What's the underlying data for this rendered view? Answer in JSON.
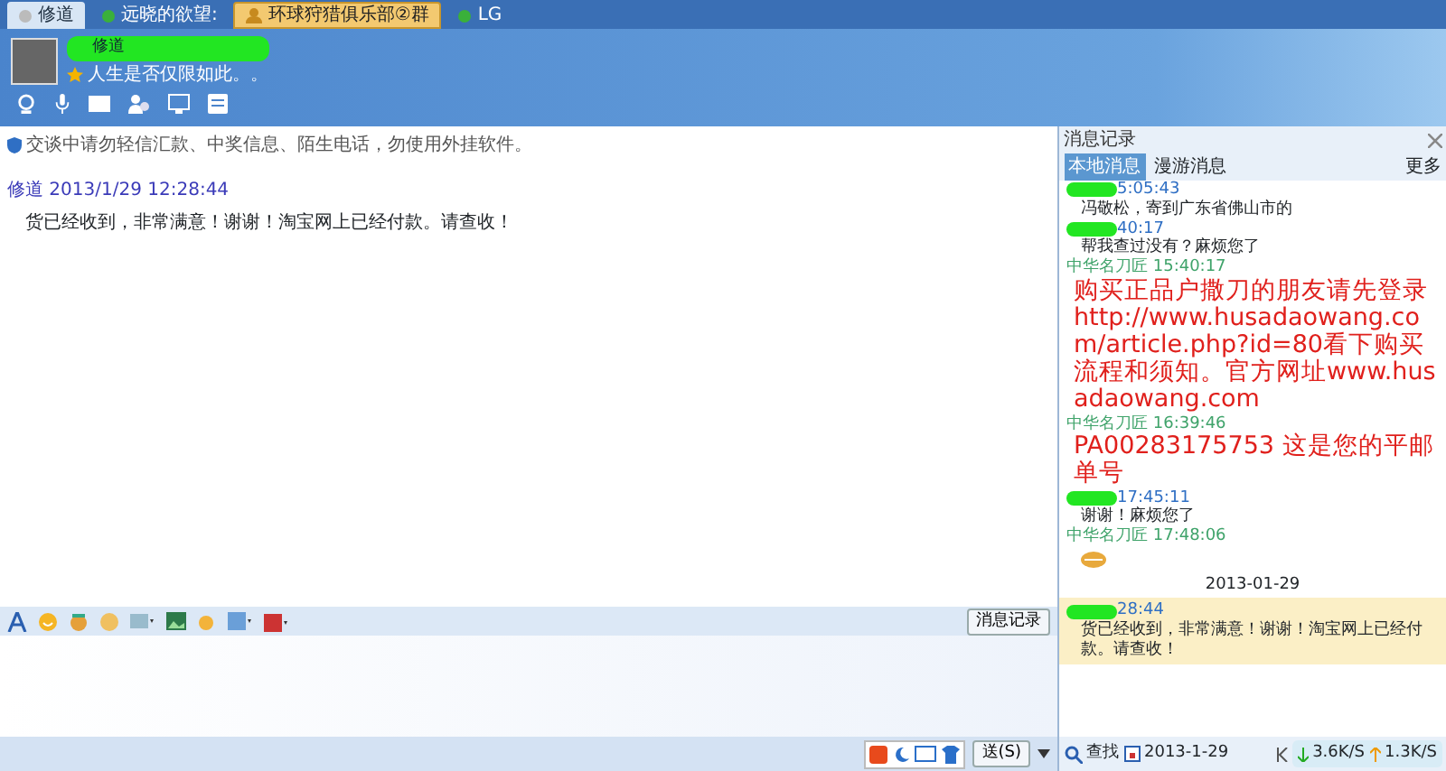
{
  "tabs": [
    {
      "label": "修道",
      "selected": true,
      "kind": "offline"
    },
    {
      "label": "远晓的欲望:",
      "selected": false,
      "kind": "online"
    },
    {
      "label": "环球狩猎俱乐部②群",
      "selected": false,
      "kind": "group"
    },
    {
      "label": "LG",
      "selected": false,
      "kind": "online"
    }
  ],
  "contact": {
    "name": "修道",
    "name_redacted": true,
    "signature": "人生是否仅限如此。。"
  },
  "notice": "交谈中请勿轻信汇款、中奖信息、陌生电话，勿使用外挂软件。",
  "messages": [
    {
      "sender": "修道",
      "time": "2013/1/29 12:28:44",
      "text": "货已经收到，非常满意！谢谢！淘宝网上已经付款。请查收！"
    }
  ],
  "history_button": "消息记录",
  "send_button": "送(S)",
  "history": {
    "title": "消息记录",
    "tabs": [
      {
        "label": "本地消息",
        "selected": true
      },
      {
        "label": "漫游消息",
        "selected": false
      }
    ],
    "more": "更多",
    "entries": [
      {
        "kind": "text",
        "own": true,
        "redacted": true,
        "time": "5:05:43",
        "text": "冯敬松，寄到广东省佛山市的"
      },
      {
        "kind": "text",
        "own": true,
        "redacted": true,
        "time": "40:17",
        "text": "帮我查过没有？麻烦您了"
      },
      {
        "kind": "big_text",
        "own": false,
        "sender": "中华名刀匠",
        "time": "15:40:17",
        "text": "购买正品户撒刀的朋友请先登录http://www.husadaowang.com/article.php?id=80看下购买流程和须知。官方网址www.husadaowang.com"
      },
      {
        "kind": "big_text",
        "own": false,
        "sender": "中华名刀匠",
        "time": "16:39:46",
        "text": "PA00283175753 这是您的平邮单号"
      },
      {
        "kind": "text",
        "own": true,
        "redacted": true,
        "time": "17:45:11",
        "text": "谢谢！麻烦您了"
      },
      {
        "kind": "emoji",
        "own": false,
        "sender": "中华名刀匠",
        "time": "17:48:06"
      },
      {
        "kind": "date",
        "text": "2013-01-29"
      },
      {
        "kind": "text",
        "own": true,
        "redacted": true,
        "time": "28:44",
        "text": "货已经收到，非常满意！谢谢！淘宝网上已经付款。请查收！",
        "highlighted": true
      }
    ],
    "search": "查找",
    "date": "2013-1-29"
  },
  "speeds": {
    "down": "3.6K/S",
    "up": "1.3K/S"
  }
}
